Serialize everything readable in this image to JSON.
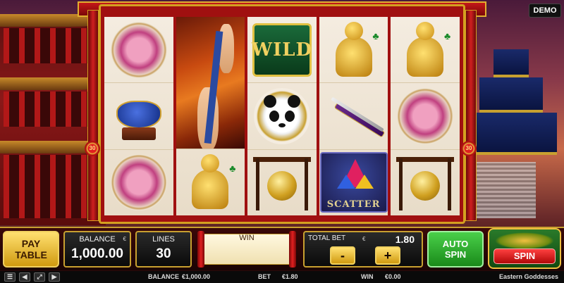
{
  "badge": {
    "demo": "DEMO"
  },
  "medals": {
    "left": "30",
    "right": "30"
  },
  "reels": [
    [
      "snake-symbol",
      "urn-symbol",
      "snake-symbol"
    ],
    [
      "goddess-symbol"
    ],
    [
      "wild-symbol",
      "panda-symbol",
      "gong-symbol"
    ],
    [
      "buddha-symbol",
      "sword-symbol",
      "scatter-symbol"
    ],
    [
      "buddha-symbol",
      "snake-symbol",
      "gong-symbol"
    ]
  ],
  "symbols": {
    "wild_label": "WILD",
    "scatter_label": "SCATTER"
  },
  "controls": {
    "paytable_line1": "PAY",
    "paytable_line2": "TABLE",
    "balance_label": "BALANCE",
    "balance_currency": "€",
    "balance_value": "1,000.00",
    "lines_label": "LINES",
    "lines_value": "30",
    "win_label": "WIN",
    "total_bet_label": "TOTAL BET",
    "total_bet_currency": "€",
    "total_bet_value": "1.80",
    "minus_label": "-",
    "plus_label": "+",
    "auto_line1": "AUTO",
    "auto_line2": "SPIN",
    "spin_label": "SPIN"
  },
  "status_bar": {
    "balance_label": "BALANCE",
    "balance_value": "€1,000.00",
    "bet_label": "BET",
    "bet_value": "€1.80",
    "win_label": "WIN",
    "win_value": "€0.00",
    "game_name": "Eastern Goddesses"
  }
}
